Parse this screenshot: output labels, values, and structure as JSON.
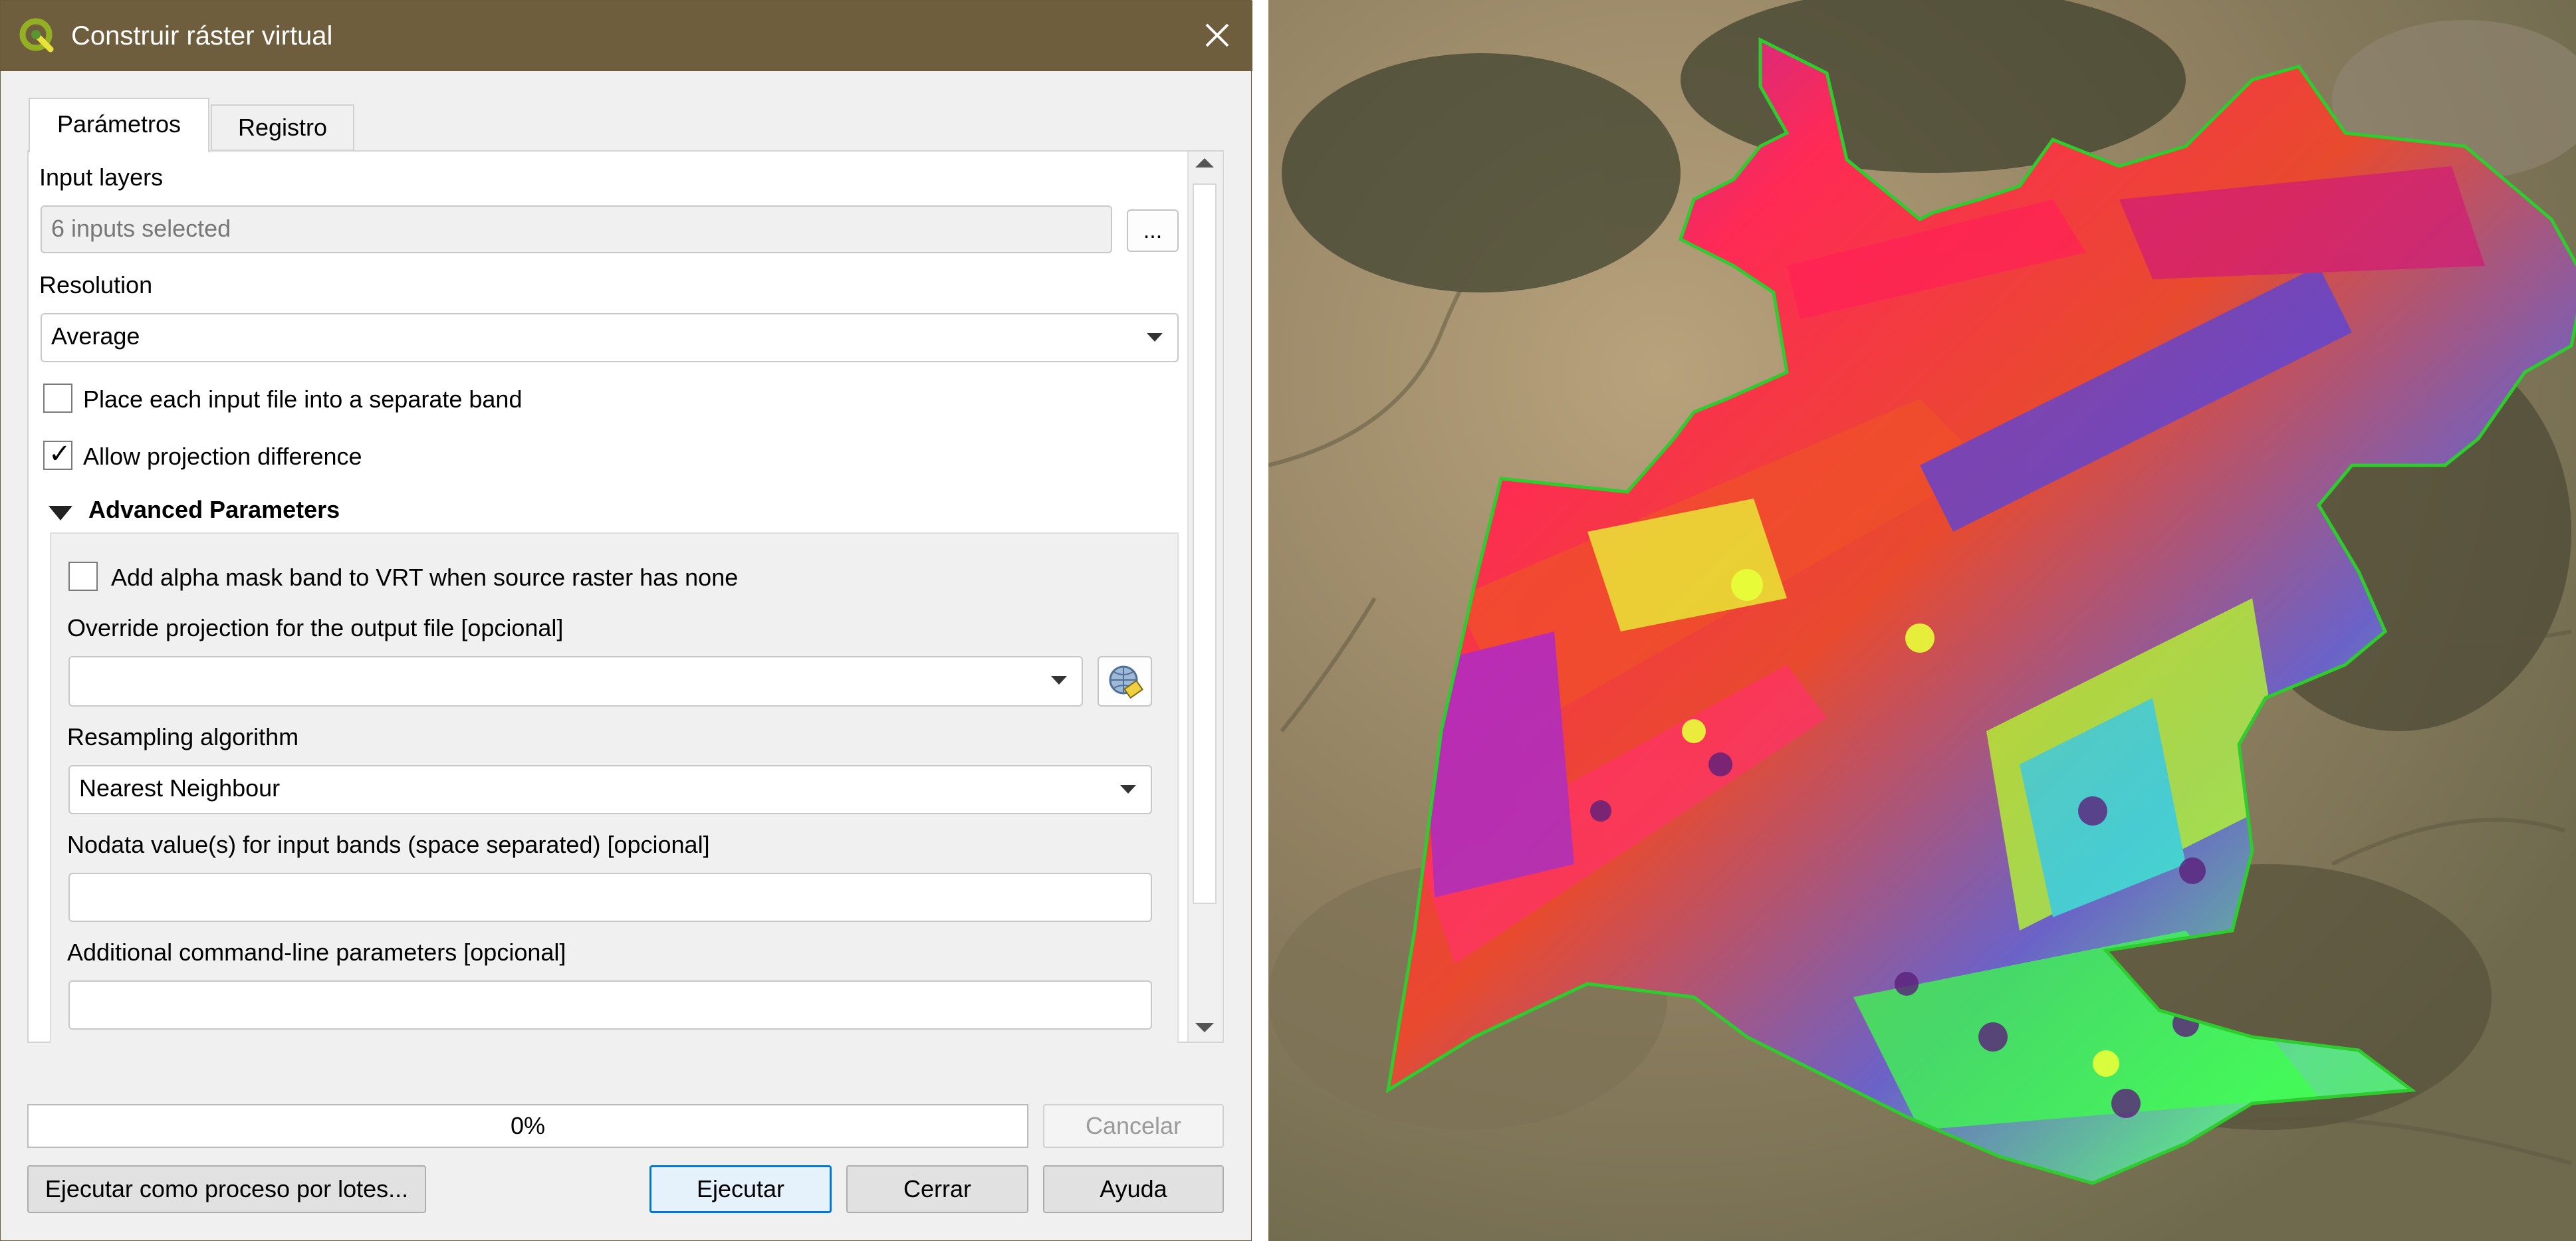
{
  "window": {
    "title": "Construir ráster virtual"
  },
  "tabs": [
    {
      "label": "Parámetros"
    },
    {
      "label": "Registro"
    }
  ],
  "params": {
    "input_layers": {
      "label": "Input layers",
      "value": "6 inputs selected",
      "browse_label": "..."
    },
    "resolution": {
      "label": "Resolution",
      "value": "Average"
    },
    "separate_band": {
      "label": "Place each input file into a separate band",
      "checked": false
    },
    "allow_projection": {
      "label": "Allow projection difference",
      "checked": true
    }
  },
  "advanced": {
    "header": "Advanced Parameters",
    "alpha_mask": {
      "label": "Add alpha mask band to VRT when source raster has none",
      "checked": false
    },
    "override_proj": {
      "label": "Override projection for the output file [opcional]",
      "value": ""
    },
    "resampling": {
      "label": "Resampling algorithm",
      "value": "Nearest Neighbour"
    },
    "nodata": {
      "label": "Nodata value(s) for input bands (space separated) [opcional]",
      "value": ""
    },
    "extra_params": {
      "label": "Additional command-line parameters [opcional]",
      "value": ""
    }
  },
  "progress": {
    "percent": 0,
    "text": "0%"
  },
  "buttons": {
    "cancel": "Cancelar",
    "batch": "Ejecutar como proceso por lotes...",
    "run": "Ejecutar",
    "close": "Cerrar",
    "help": "Ayuda"
  },
  "colors": {
    "titlebar": "#6e5e3e",
    "accent": "#0078d7",
    "progress_fill": "#06b025",
    "boundary": "#2ecc2e"
  }
}
